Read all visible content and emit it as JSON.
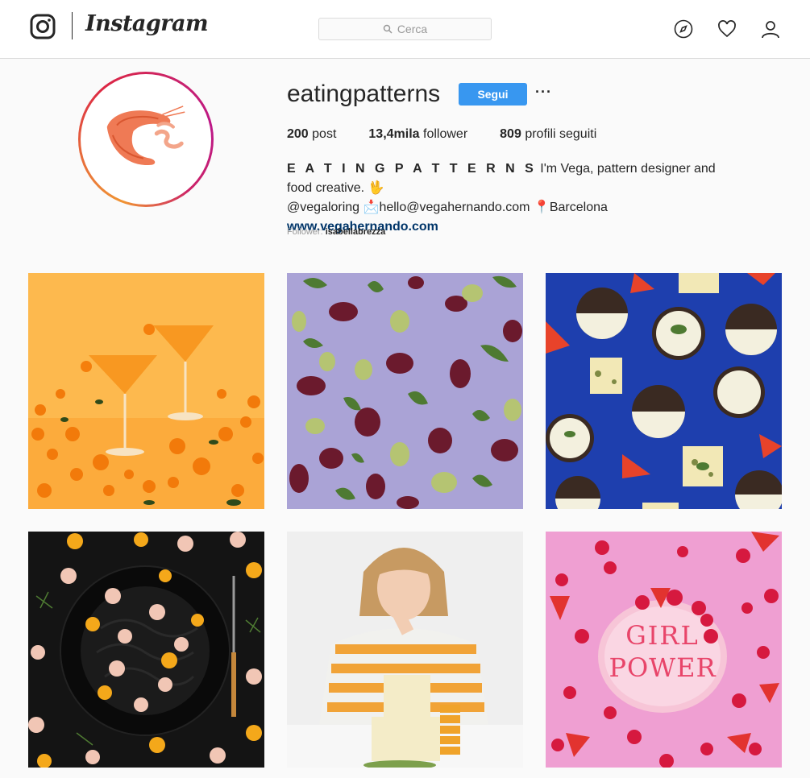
{
  "nav": {
    "wordmark": "Instagram",
    "search_placeholder": "Cerca",
    "icons": [
      "instagram-logo-icon",
      "search-icon",
      "compass-icon",
      "heart-icon",
      "user-icon"
    ]
  },
  "profile": {
    "username": "eatingpatterns",
    "follow_label": "Segui",
    "more_label": "···",
    "stats": {
      "posts_value": "200",
      "posts_label": "post",
      "followers_value": "13,4mila",
      "followers_label": "follower",
      "following_value": "809",
      "following_label": "profili seguiti"
    },
    "bio": {
      "display_name": "E A T I N G P A T T E R N S",
      "line1_text": " I'm Vega, pattern designer and food creative. ",
      "line1_emoji": "🖖",
      "handle": "@vegaloring",
      "email_emoji": "📩",
      "email": "hello@vegahernando.com",
      "pin_emoji": "📍",
      "location": "Barcelona",
      "website": "www.vegahernando.com"
    },
    "followed_by_label": "Follower:",
    "followed_by_user": "isabellabrezza"
  },
  "posts": [
    {
      "subject": "orange-cocktails",
      "bg": "#fdb94e"
    },
    {
      "subject": "olives-pattern",
      "bg": "#aaa3d6"
    },
    {
      "subject": "cheese-crackers-pattern",
      "bg": "#1e3fae"
    },
    {
      "subject": "black-pasta-shrimp",
      "bg": "#141414"
    },
    {
      "subject": "portrait-with-cheese",
      "bg": "#efefef"
    },
    {
      "subject": "girl-power-cake",
      "bg": "#ef9fd2"
    }
  ],
  "colors": {
    "accent": "#3897f0",
    "link": "#003569",
    "text": "#262626",
    "muted": "#999999"
  }
}
